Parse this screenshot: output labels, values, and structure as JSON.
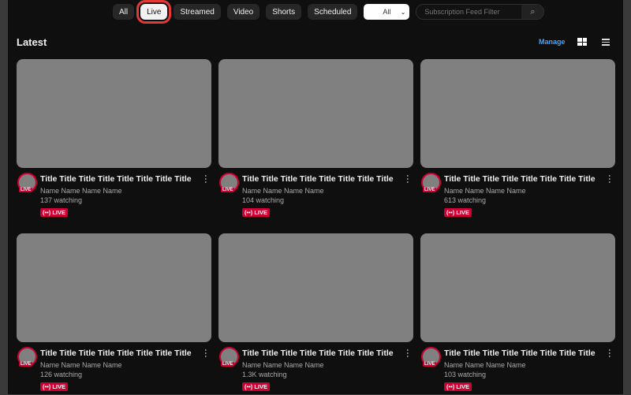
{
  "filters": {
    "chips": [
      "All",
      "Live",
      "Streamed",
      "Video",
      "Shorts",
      "Scheduled"
    ],
    "active": 1,
    "select_value": "All",
    "search_placeholder": "Subscription Feed Filter"
  },
  "section": {
    "title": "Latest",
    "manage_label": "Manage"
  },
  "colors": {
    "accent": "#3ea6ff",
    "live": "#cc0033",
    "highlight": "#e53935"
  },
  "videos": [
    {
      "title": "Title Title Title Title Title Title Title Title",
      "channel": "Name Name Name Name",
      "viewers": "137 watching",
      "badge": "LIVE",
      "avatar_badge": "LIVE"
    },
    {
      "title": "Title Title Title Title Title Title Title Title",
      "channel": "Name Name Name Name",
      "viewers": "104 watching",
      "badge": "LIVE",
      "avatar_badge": "LIVE"
    },
    {
      "title": "Title Title Title Title Title Title Title Title",
      "channel": "Name Name Name Name",
      "viewers": "613 watching",
      "badge": "LIVE",
      "avatar_badge": "LIVE"
    },
    {
      "title": "Title Title Title Title Title Title Title Title",
      "channel": "Name Name Name Name",
      "viewers": "126 watching",
      "badge": "LIVE",
      "avatar_badge": "LIVE"
    },
    {
      "title": "Title Title Title Title Title Title Title Title",
      "channel": "Name Name Name Name",
      "viewers": "1.3K watching",
      "badge": "LIVE",
      "avatar_badge": "LIVE"
    },
    {
      "title": "Title Title Title Title Title Title Title Title",
      "channel": "Name Name Name Name",
      "viewers": "103 watching",
      "badge": "LIVE",
      "avatar_badge": "LIVE"
    }
  ]
}
